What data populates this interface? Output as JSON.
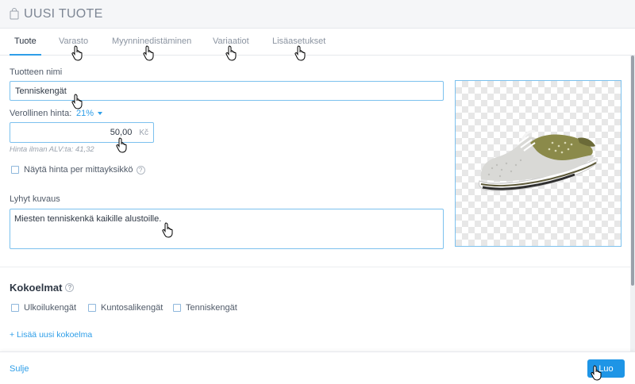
{
  "header": {
    "title": "UUSI TUOTE",
    "icon": "shopping-bag-icon"
  },
  "tabs": [
    {
      "label": "Tuote",
      "active": true
    },
    {
      "label": "Varasto",
      "active": false
    },
    {
      "label": "Myynninedistäminen",
      "active": false
    },
    {
      "label": "Variaatiot",
      "active": false
    },
    {
      "label": "Lisäasetukset",
      "active": false
    }
  ],
  "form": {
    "name_label": "Tuotteen nimi",
    "name_value": "Tenniskengät",
    "price_label": "Verollinen hinta:",
    "vat_rate": "21%",
    "price_value": "50,00",
    "currency": "Kč",
    "price_hint": "Hinta ilman ALV:ta: 41,32",
    "per_unit_label": "Näytä hinta per mittayksikkö",
    "desc_label": "Lyhyt kuvaus",
    "desc_value": "Miesten tenniskenkä kaikille alustoille."
  },
  "collections": {
    "title": "Kokoelmat",
    "items": [
      {
        "label": "Ulkoilukengät",
        "checked": false
      },
      {
        "label": "Kuntosalikengät",
        "checked": false
      },
      {
        "label": "Tenniskengät",
        "checked": false
      }
    ],
    "add_label": "+ Lisää uusi kokoelma"
  },
  "footer": {
    "close_label": "Sulje",
    "create_label": "Luo"
  },
  "colors": {
    "accent": "#1e95e6",
    "border": "#7cc1ee",
    "shoe_olive": "#8b8a4a"
  }
}
